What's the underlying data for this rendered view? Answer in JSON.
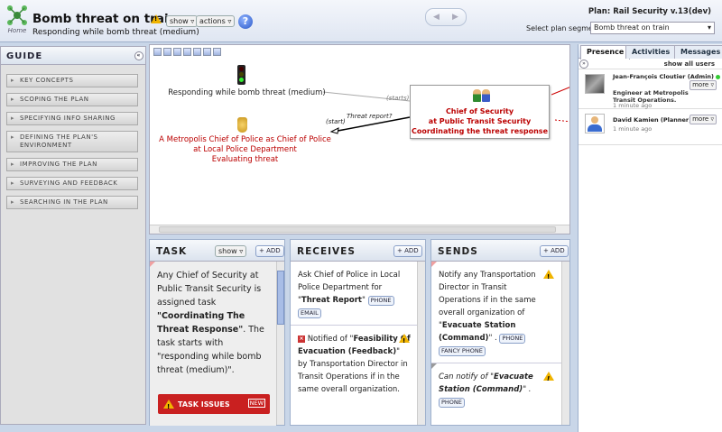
{
  "header": {
    "logo_label": "Home",
    "title": "Bomb threat on train",
    "subtitle": "Responding while bomb threat (medium)",
    "show_label": "show",
    "actions_label": "actions",
    "help_label": "?",
    "plan": "Plan: Rail Security v.13(dev)",
    "segment_label": "Select plan segment:",
    "segment_value": "Bomb threat on train"
  },
  "guide": {
    "title": "GUIDE",
    "items": [
      {
        "label": "KEY CONCEPTS"
      },
      {
        "label": "SCOPING THE PLAN"
      },
      {
        "label": "SPECIFYING INFO SHARING"
      },
      {
        "label": "DEFINING THE PLAN'S ENVIRONMENT"
      },
      {
        "label": "IMPROVING THE PLAN"
      },
      {
        "label": "SURVEYING AND FEEDBACK"
      },
      {
        "label": "SEARCHING IN THE PLAN"
      }
    ]
  },
  "map": {
    "node_event": "Responding while bomb threat (medium)",
    "node_police_1": "A Metropolis Chief of Police as Chief of Police",
    "node_police_2": "at Local Police Department",
    "node_police_3": "Evaluating threat",
    "box_line1": "Chief of Security",
    "box_line2": "at Public Transit Security",
    "box_line3": "Coordinating the threat response",
    "edge_starts": "(starts)",
    "edge_start": "(start)",
    "edge_threat": "Threat report?"
  },
  "task": {
    "title": "TASK",
    "show_label": "show",
    "add_label": "+ ADD",
    "text_1": "Any Chief of Security at Public Transit Security is assigned task",
    "task_name": "\"Coordinating The Threat Response\"",
    "text_2": ". The task starts with \"responding while bomb threat (medium)\".",
    "issues_label": "TASK ISSUES",
    "new_label": "NEW"
  },
  "receives": {
    "title": "RECEIVES",
    "add_label": "+ ADD",
    "r1_text": "Ask Chief of Police in Local Police Department for \"",
    "r1_bold": "Threat Report",
    "r1_end": "\"",
    "r1_tags": [
      "PHONE",
      "EMAIL"
    ],
    "r2_prefix": "Notified of \"",
    "r2_bold": "Feasibility Of Evacuation (Feedback)",
    "r2_text": "\" by Transportation Director in Transit Operations if in the same overall organization."
  },
  "sends": {
    "title": "SENDS",
    "add_label": "+ ADD",
    "s1_text": "Notify any Transportation Director in Transit Operations if in the same overall organization of \"",
    "s1_bold": "Evacuate Station (Command)",
    "s1_end": "\" .",
    "s1_tags": [
      "PHONE",
      "FANCY PHONE"
    ],
    "s2_prefix": "Can notify of \"",
    "s2_bold": "Evacuate Station (Command)",
    "s2_end": "\" .",
    "s2_tags": [
      "PHONE"
    ]
  },
  "presence": {
    "tabs": [
      "Presence",
      "Activities",
      "Messages"
    ],
    "show_all": "show all users",
    "users": [
      {
        "name": "Jean-François Cloutier (Admin)",
        "more": "more",
        "role": "Engineer at Metropolis Transit Operations.",
        "time": "1 minute ago"
      },
      {
        "name": "David Kamien (Planner)",
        "more": "more",
        "time": "1 minute ago"
      }
    ]
  },
  "colors": {
    "accent_red": "#b00000",
    "brand_blue": "#2a58c8",
    "warning": "#f0b400"
  }
}
